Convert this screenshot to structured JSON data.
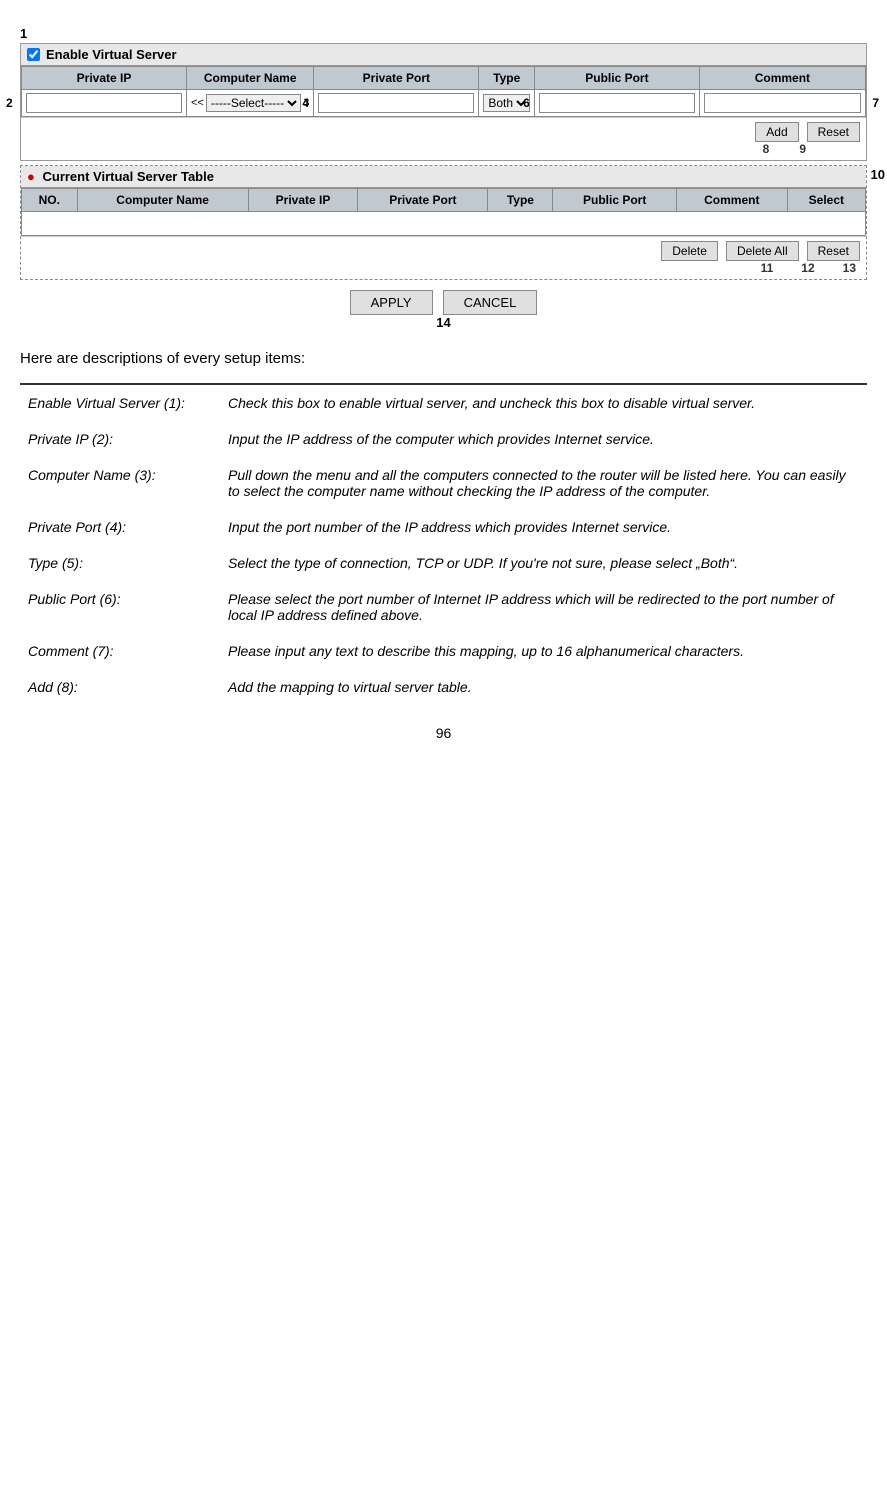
{
  "page": {
    "number": "96"
  },
  "virtual_server": {
    "enable_label": "Enable Virtual Server",
    "num1": "1",
    "num2": "2",
    "num3": "3",
    "num4": "4",
    "num5": "5",
    "num6": "6",
    "num7": "7",
    "num8": "8",
    "num9": "9",
    "num10": "10",
    "num11": "11",
    "num12": "12",
    "num13": "13",
    "num14": "14",
    "columns": {
      "private_ip": "Private IP",
      "computer_name": "Computer Name",
      "private_port": "Private Port",
      "type": "Type",
      "public_port": "Public Port",
      "comment": "Comment"
    },
    "select_placeholder": "-----Select------",
    "type_value": "Both",
    "add_btn": "Add",
    "reset_btn": "Reset",
    "current_table": {
      "title": "Current Virtual Server Table",
      "columns": {
        "no": "NO.",
        "computer_name": "Computer Name",
        "private_ip": "Private IP",
        "private_port": "Private Port",
        "type": "Type",
        "public_port": "Public Port",
        "comment": "Comment",
        "select": "Select"
      },
      "delete_btn": "Delete",
      "delete_all_btn": "Delete All",
      "reset_btn": "Reset"
    },
    "apply_btn": "APPLY",
    "cancel_btn": "CANCEL"
  },
  "descriptions": {
    "intro": "Here are descriptions of every setup items:",
    "items": [
      {
        "term": "Enable Virtual Server (1):",
        "desc": "Check this box to enable virtual server, and uncheck this box to disable virtual server."
      },
      {
        "term": "Private IP (2):",
        "desc": "Input the IP address of the computer which provides Internet service."
      },
      {
        "term": "Computer Name (3):",
        "desc": "Pull down the menu and all the computers connected to the router will be listed here. You can easily to select the computer name without checking the IP address of the computer."
      },
      {
        "term": "Private Port (4):",
        "desc": "Input the port number of the IP address which provides Internet service."
      },
      {
        "term": "Type (5):",
        "desc": "Select the type of connection, TCP or UDP. If you're not sure, please select „Both“."
      },
      {
        "term": "Public Port (6):",
        "desc": "Please select the port number of Internet IP address which will be redirected to the port number of local IP address defined above."
      },
      {
        "term": "Comment (7):",
        "desc": "Please input any text to describe this mapping, up to 16 alphanumerical characters."
      },
      {
        "term": "Add (8):",
        "desc": "Add the mapping to virtual server table."
      }
    ]
  }
}
